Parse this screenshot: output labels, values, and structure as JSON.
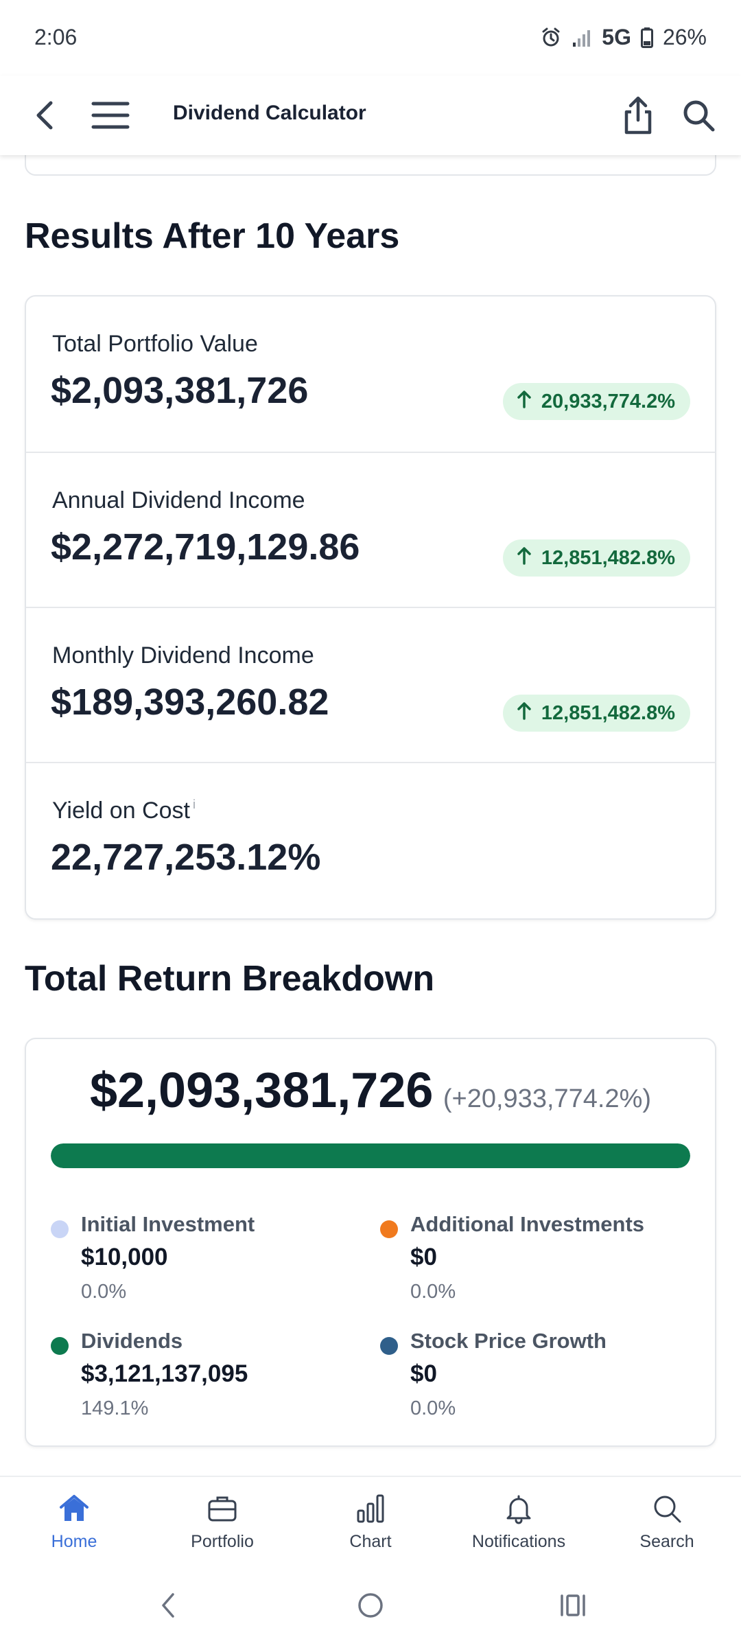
{
  "status_bar": {
    "time": "2:06",
    "network": "5G",
    "battery": "26%"
  },
  "header": {
    "title": "Dividend Calculator",
    "icons": [
      "back-arrow-icon",
      "menu-icon",
      "share-icon",
      "search-icon"
    ]
  },
  "results": {
    "title": "Results After 10 Years",
    "rows": [
      {
        "label": "Total Portfolio Value",
        "value": "$2,093,381,726",
        "change": "20,933,774.2%"
      },
      {
        "label": "Annual Dividend Income",
        "value": "$2,272,719,129.86",
        "change": "12,851,482.8%"
      },
      {
        "label": "Monthly Dividend Income",
        "value": "$189,393,260.82",
        "change": "12,851,482.8%"
      },
      {
        "label": "Yield on Cost",
        "info": "i",
        "value": "22,727,253.12%"
      }
    ]
  },
  "breakdown": {
    "title": "Total Return Breakdown",
    "total_value": "$2,093,381,726",
    "total_change": "(+20,933,774.2%)",
    "bar_fill_percent": 100,
    "colors": {
      "bar": "#0d7a4f",
      "badge_bg": "#dff6e6",
      "badge_text": "#13693d",
      "accent": "#3a6fd8"
    },
    "legend": [
      {
        "name": "Initial Investment",
        "amount": "$10,000",
        "percent": "0.0%",
        "color": "#c9d5f6"
      },
      {
        "name": "Additional Investments",
        "amount": "$0",
        "percent": "0.0%",
        "color": "#f07a1e"
      },
      {
        "name": "Dividends",
        "amount": "$3,121,137,095",
        "percent": "149.1%",
        "color": "#0d7a4f"
      },
      {
        "name": "Stock Price Growth",
        "amount": "$0",
        "percent": "0.0%",
        "color": "#2f5f8a"
      }
    ]
  },
  "bottom_nav": {
    "items": [
      {
        "label": "Home",
        "icon": "home-icon",
        "active": true
      },
      {
        "label": "Portfolio",
        "icon": "briefcase-icon"
      },
      {
        "label": "Chart",
        "icon": "bar-chart-icon"
      },
      {
        "label": "Notifications",
        "icon": "bell-icon"
      },
      {
        "label": "Search",
        "icon": "search-icon"
      }
    ]
  }
}
